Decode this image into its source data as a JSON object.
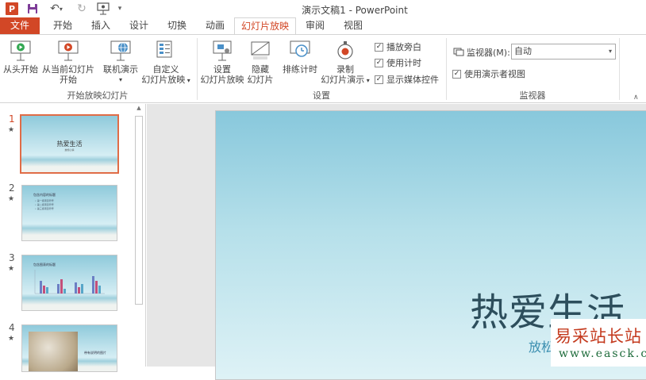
{
  "titlebar": {
    "title": "演示文稿1 - PowerPoint",
    "icons": [
      "powerpoint-logo",
      "save-icon",
      "undo-icon",
      "redo-icon",
      "presentation-icon",
      "customize-qat-icon"
    ]
  },
  "tabs": [
    {
      "label": "文件"
    },
    {
      "label": "开始"
    },
    {
      "label": "插入"
    },
    {
      "label": "设计"
    },
    {
      "label": "切换"
    },
    {
      "label": "动画"
    },
    {
      "label": "幻灯片放映"
    },
    {
      "label": "审阅"
    },
    {
      "label": "视图"
    }
  ],
  "ribbon": {
    "groups": {
      "start": "开始放映幻灯片",
      "setup": "设置",
      "monitors": "监视器"
    },
    "from_beginning": "从头开始",
    "from_current_1": "从当前幻灯片",
    "from_current_2": "开始",
    "online_present": "联机演示",
    "custom_show_1": "自定义",
    "custom_show_2": "幻灯片放映",
    "setup_show_1": "设置",
    "setup_show_2": "幻灯片放映",
    "hide_slide_1": "隐藏",
    "hide_slide_2": "幻灯片",
    "rehearse": "排练计时",
    "record_1": "录制",
    "record_2": "幻灯片演示",
    "play_narrations": "播放旁白",
    "use_timings": "使用计时",
    "show_media_controls": "显示媒体控件",
    "monitor_label": "监视器(M):",
    "monitor_value": "自动",
    "presenter_view": "使用演示者视图"
  },
  "slides": [
    {
      "num": "1",
      "title": "热爱生活",
      "sub": "放松心情"
    },
    {
      "num": "2",
      "title": "包含内容的标题",
      "bullets": [
        "• 第一级项目符号",
        "• 第二级项目符号",
        "• 第三级项目符号"
      ]
    },
    {
      "num": "3",
      "title": "包含图表的标题"
    },
    {
      "num": "4",
      "title": "带有说明的图片"
    }
  ],
  "main_slide": {
    "title": "热爱生活",
    "subtitle": "放松"
  },
  "watermark": {
    "cn": "易采站长站",
    "en": "www.easck.com"
  },
  "colors": {
    "accent": "#d24726",
    "slide_top": "#88c8dc",
    "slide_bottom": "#def2f6"
  }
}
